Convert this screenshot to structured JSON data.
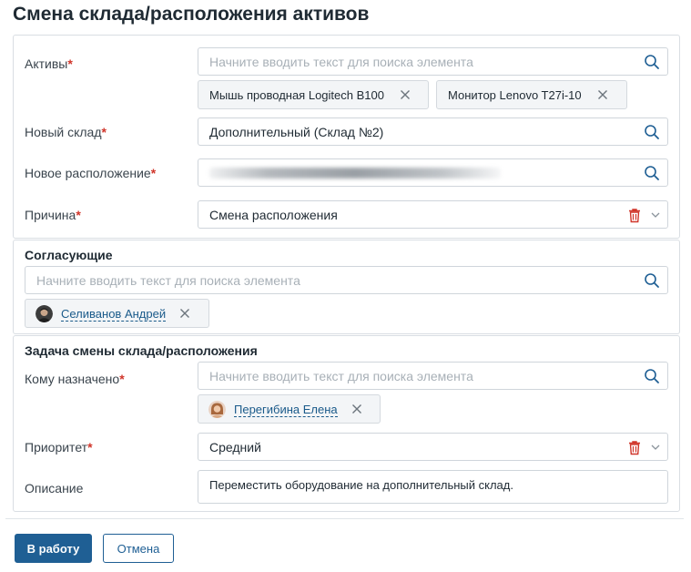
{
  "page": {
    "title": "Смена склада/расположения активов"
  },
  "form": {
    "assets": {
      "label": "Активы",
      "placeholder": "Начните вводить текст для поиска элемента",
      "tags": [
        "Мышь проводная Logitech B100",
        "Монитор Lenovo T27i-10"
      ]
    },
    "new_warehouse": {
      "label": "Новый склад",
      "value": "Дополнительный (Склад №2)"
    },
    "new_location": {
      "label": "Новое расположение"
    },
    "reason": {
      "label": "Причина",
      "value": "Смена расположения"
    }
  },
  "approvers": {
    "title": "Согласующие",
    "placeholder": "Начните вводить текст для поиска элемента",
    "tag": "Селиванов Андрей"
  },
  "task": {
    "title": "Задача смены склада/расположения",
    "assignee": {
      "label": "Кому назначено",
      "placeholder": "Начните вводить текст для поиска элемента",
      "tag": "Перегибина Елена"
    },
    "priority": {
      "label": "Приоритет",
      "value": "Средний"
    },
    "description": {
      "label": "Описание",
      "value": "Переместить оборудование на дополнительный склад."
    }
  },
  "required_mark": "*",
  "buttons": {
    "submit": "В работу",
    "cancel": "Отмена"
  },
  "icons": {
    "search": "search-icon",
    "close": "close-icon",
    "trash": "trash-icon",
    "chevron": "chevron-down-icon",
    "avatar": "avatar"
  },
  "colors": {
    "primary": "#1f5f94",
    "required": "#d0352a",
    "trash": "#d0352a",
    "link": "#1a5a8a"
  }
}
